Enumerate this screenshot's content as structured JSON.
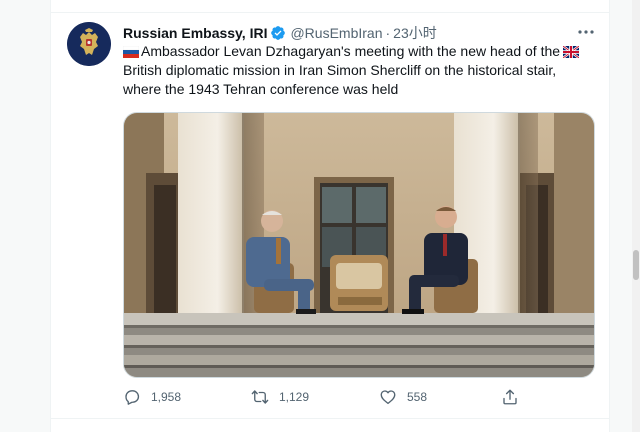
{
  "tweet": {
    "author_name": "Russian Embassy, IRI",
    "handle": "@RusEmbIran",
    "separator": "·",
    "time": "23小时",
    "text_part1": "Ambassador Levan Dzhagaryan's meeting with the new head of the",
    "text_part2": "British diplomatic mission in Iran Simon Shercliff on the historical stair, where the 1943 Tehran conference was held",
    "flag_start": "russia-flag",
    "flag_mid": "uk-flag",
    "avatar_icon": "russian-coat-of-arms",
    "media_description_icon": "photo"
  },
  "actions": {
    "replies": "1,958",
    "retweets": "1,129",
    "likes": "558"
  },
  "colors": {
    "accent": "#1d9bf0",
    "text": "#0f1419",
    "secondary": "#536471",
    "avatar_bg": "#162a5c"
  }
}
